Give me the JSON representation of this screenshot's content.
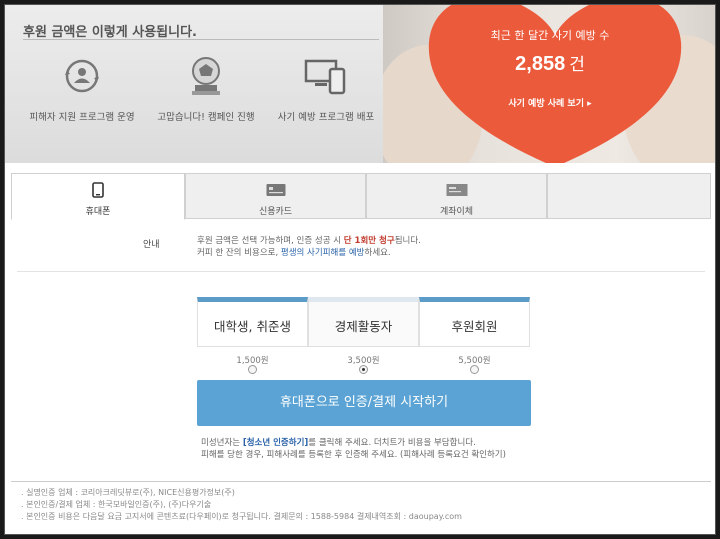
{
  "banner": {
    "title": "후원 금액은 이렇게 사용됩니다.",
    "features": [
      {
        "icon": "support-user-icon",
        "label": "피해자 지원 프로그램 운영"
      },
      {
        "icon": "campaign-badge-icon",
        "label": "고맙습니다! 캠페인 진행"
      },
      {
        "icon": "devices-icon",
        "label": "사기 예방 프로그램 배포"
      }
    ],
    "stat_label": "최근 한 달간 사기 예방 수",
    "stat_value": "2,858",
    "stat_unit": "건",
    "stat_link": "사기 예방 사례 보기 ▸",
    "heart_color": "#ec5a3c"
  },
  "tabs": [
    {
      "icon": "mobile-phone-icon",
      "label": "휴대폰",
      "active": true
    },
    {
      "icon": "credit-card-icon",
      "label": "신용카드",
      "active": false
    },
    {
      "icon": "bank-transfer-icon",
      "label": "계좌이체",
      "active": false
    }
  ],
  "notice": {
    "label": "안내",
    "line1_a": "후원 금액은 선택 가능하며, 인증 성공 시 ",
    "line1_b": "단 1회만 청구",
    "line1_c": "됩니다.",
    "line2_a": "커피 한 잔의 비용으로, ",
    "line2_b": "평생의 사기피해를 예방",
    "line2_c": "하세요."
  },
  "options": [
    {
      "label": "대학생, 취준생",
      "price": "1,500원",
      "selected": false
    },
    {
      "label": "경제활동자",
      "price": "3,500원",
      "selected": true
    },
    {
      "label": "후원회원",
      "price": "5,500원",
      "selected": false
    }
  ],
  "cta_label": "휴대폰으로 인증/결제 시작하기",
  "help": {
    "l1_a": "미성년자는 ",
    "l1_link": "[청소년 인증하기]",
    "l1_b": "를 클릭해 주세요. 더치트가 비용을 부담합니다.",
    "l2": "피해를 당한 경우, 피해사례를 등록한 후 인증해 주세요. (피해사례 등록요건 확인하기)"
  },
  "footer": [
    ". 실명인증 업체 : 코리아크레딧뷰로(주), NICE신용평가정보(주)",
    ". 본인인증/결제 업체 : 한국모바일인증(주), (주)다우기술",
    ". 본인인증 비용은 다음달 요금 고지서에 콘텐츠료(다우페이)로 청구됩니다. 결제문의 : 1588-5984 결제내역조회 : daoupay.com"
  ],
  "colors": {
    "accent": "#5aa3d4",
    "tab_bar": "#5b9bc8",
    "highlight_red": "#c0392b",
    "link_blue": "#2a63a8"
  }
}
